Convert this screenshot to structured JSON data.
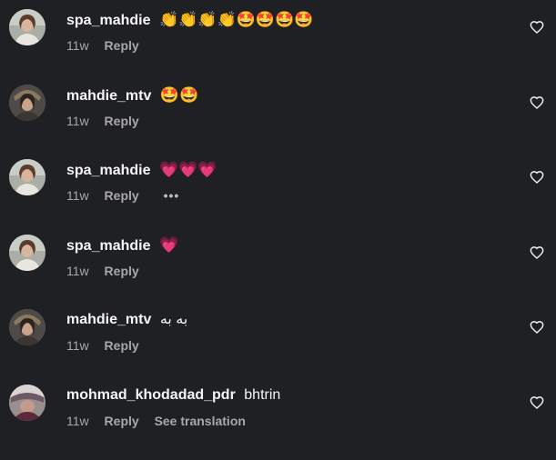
{
  "comments": [
    {
      "username": "spa_mahdie",
      "text": "👏👏👏👏🤩🤩🤩🤩",
      "time": "11w",
      "reply": "Reply",
      "more": "",
      "translate": "",
      "avatar_icon": "profile-photo"
    },
    {
      "username": "mahdie_mtv",
      "text": "🤩🤩",
      "time": "11w",
      "reply": "Reply",
      "more": "",
      "translate": "",
      "avatar_icon": "profile-photo"
    },
    {
      "username": "spa_mahdie",
      "text": "💗💗💗",
      "time": "11w",
      "reply": "Reply",
      "more": "•••",
      "translate": "",
      "avatar_icon": "profile-photo"
    },
    {
      "username": "spa_mahdie",
      "text": "💗",
      "time": "11w",
      "reply": "Reply",
      "more": "",
      "translate": "",
      "avatar_icon": "profile-photo"
    },
    {
      "username": "mahdie_mtv",
      "text": "به به",
      "time": "11w",
      "reply": "Reply",
      "more": "",
      "translate": "",
      "avatar_icon": "profile-photo"
    },
    {
      "username": "mohmad_khodadad_pdr",
      "text": "bhtrin",
      "time": "11w",
      "reply": "Reply",
      "more": "",
      "translate": "See translation",
      "avatar_icon": "profile-photo"
    }
  ],
  "icons": {
    "like": "heart-outline-icon",
    "more": "more-options-icon"
  },
  "colors": {
    "background": "#1f2024",
    "primary_text": "#f5f5f5",
    "secondary_text": "#a8a8a8"
  }
}
